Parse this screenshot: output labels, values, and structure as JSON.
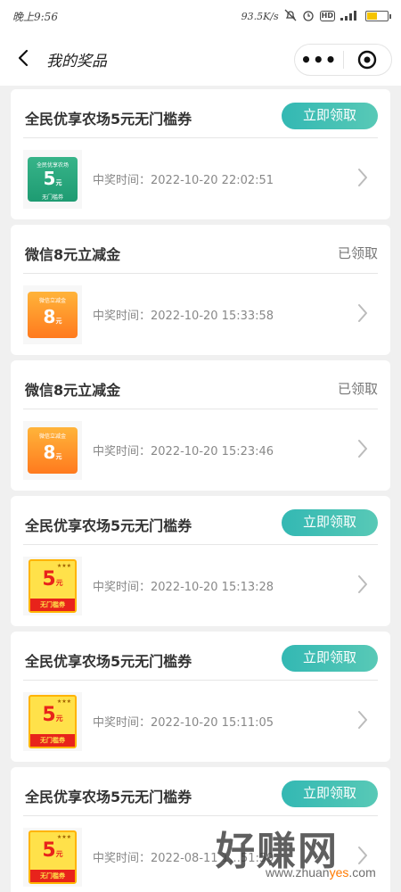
{
  "statusbar": {
    "time": "晚上9:56",
    "speed": "93.5K/s",
    "hd": "HD",
    "battery_level": 0.45,
    "battery_color": "#f5c400"
  },
  "navbar": {
    "title": "我的奖品",
    "back_icon": "chevron-left-icon",
    "more_icon": "more-dots-icon",
    "close_icon": "target-circle-icon"
  },
  "labels": {
    "claim": "立即领取",
    "claimed": "已领取",
    "win_time_prefix": "中奖时间："
  },
  "prizes": [
    {
      "title": "全民优享农场5元无门槛券",
      "status": "claim",
      "time": "中奖时间：2022-10-20 22:02:51",
      "coupon": "green",
      "coupon_top": "全民优享农场",
      "coupon_value": "5",
      "coupon_unit": "元",
      "coupon_sub": "无门槛券"
    },
    {
      "title": "微信8元立减金",
      "status": "claimed",
      "time": "中奖时间：2022-10-20 15:33:58",
      "coupon": "orange",
      "coupon_top": "微信立减金",
      "coupon_value": "8",
      "coupon_unit": "元"
    },
    {
      "title": "微信8元立减金",
      "status": "claimed",
      "time": "中奖时间：2022-10-20 15:23:46",
      "coupon": "orange",
      "coupon_top": "微信立减金",
      "coupon_value": "8",
      "coupon_unit": "元"
    },
    {
      "title": "全民优享农场5元无门槛券",
      "status": "claim",
      "time": "中奖时间：2022-10-20 15:13:28",
      "coupon": "yellow",
      "coupon_value": "5",
      "coupon_unit": "元",
      "coupon_sub": "无门槛券"
    },
    {
      "title": "全民优享农场5元无门槛券",
      "status": "claim",
      "time": "中奖时间：2022-10-20 15:11:05",
      "coupon": "yellow",
      "coupon_value": "5",
      "coupon_unit": "元",
      "coupon_sub": "无门槛券"
    },
    {
      "title": "全民优享农场5元无门槛券",
      "status": "claim",
      "time": "中奖时间：2022-08-11 1…51:59",
      "coupon": "yellow",
      "coupon_value": "5",
      "coupon_unit": "元",
      "coupon_sub": "无门槛券"
    }
  ],
  "watermark": {
    "big": "好赚网",
    "small_a": "www.zhuan",
    "small_b": "yes",
    "small_c": ".com",
    "accent": "#ff7a00"
  },
  "colors": {
    "claim_button": "#33b8b3",
    "page_bg": "#f0f0f0"
  }
}
